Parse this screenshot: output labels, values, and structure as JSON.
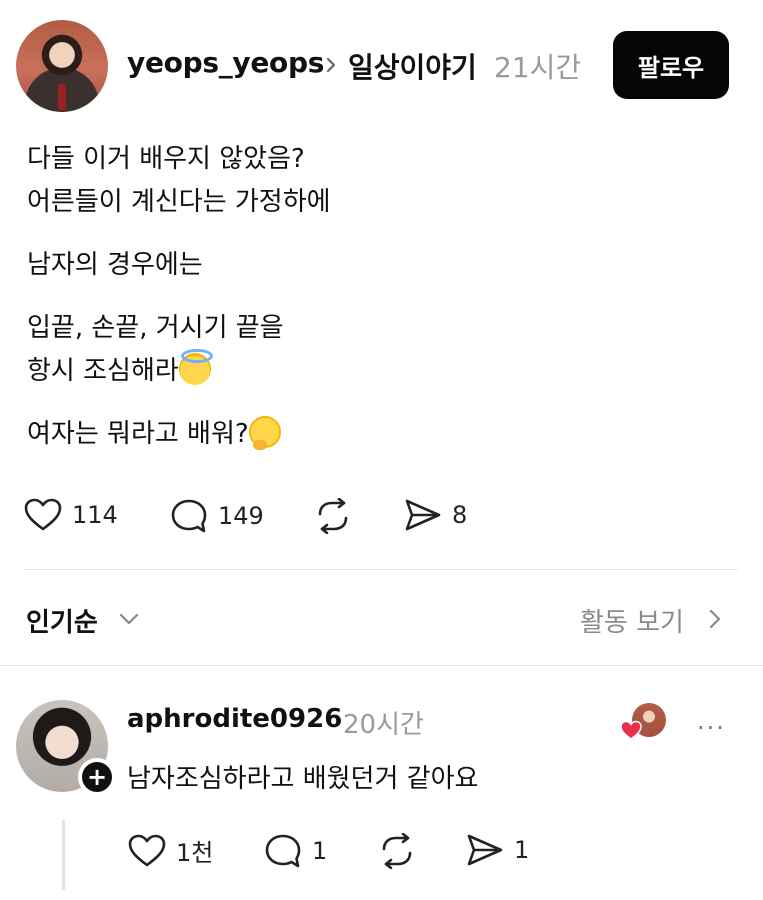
{
  "post": {
    "username": "yeops_yeops",
    "topic": "일상이야기",
    "time_ago": "21시간",
    "follow_label": "팔로우",
    "body": {
      "para1_line1": "다들 이거 배우지 않았음?",
      "para1_line2": "어른들이 계신다는 가정하에",
      "para2_line1": "남자의 경우에는",
      "para3_line1": "입끝, 손끝, 거시기 끝을",
      "para3_line2": "항시 조심해라",
      "para4_line1": "여자는 뭐라고 배워?"
    },
    "emojis": {
      "halo": "smiling-face-with-halo",
      "thinking": "thinking-face"
    },
    "counts": {
      "likes": "114",
      "comments": "149",
      "shares": "8"
    }
  },
  "sort": {
    "label": "인기순",
    "activity_label": "활동 보기"
  },
  "reply": {
    "username": "aphrodite0926",
    "time_ago": "20시간",
    "text": "남자조심하라고 배웠던거 같아요",
    "more": "···",
    "counts": {
      "likes": "1천",
      "comments": "1",
      "shares": "1"
    }
  },
  "colors": {
    "follow_bg": "#050505",
    "muted_text": "#9a9a9a",
    "heart": "#e8304a"
  },
  "icons": [
    "heart-icon",
    "comment-icon",
    "repost-icon",
    "share-icon",
    "chevron-right-icon",
    "chevron-down-icon",
    "plus-icon"
  ]
}
